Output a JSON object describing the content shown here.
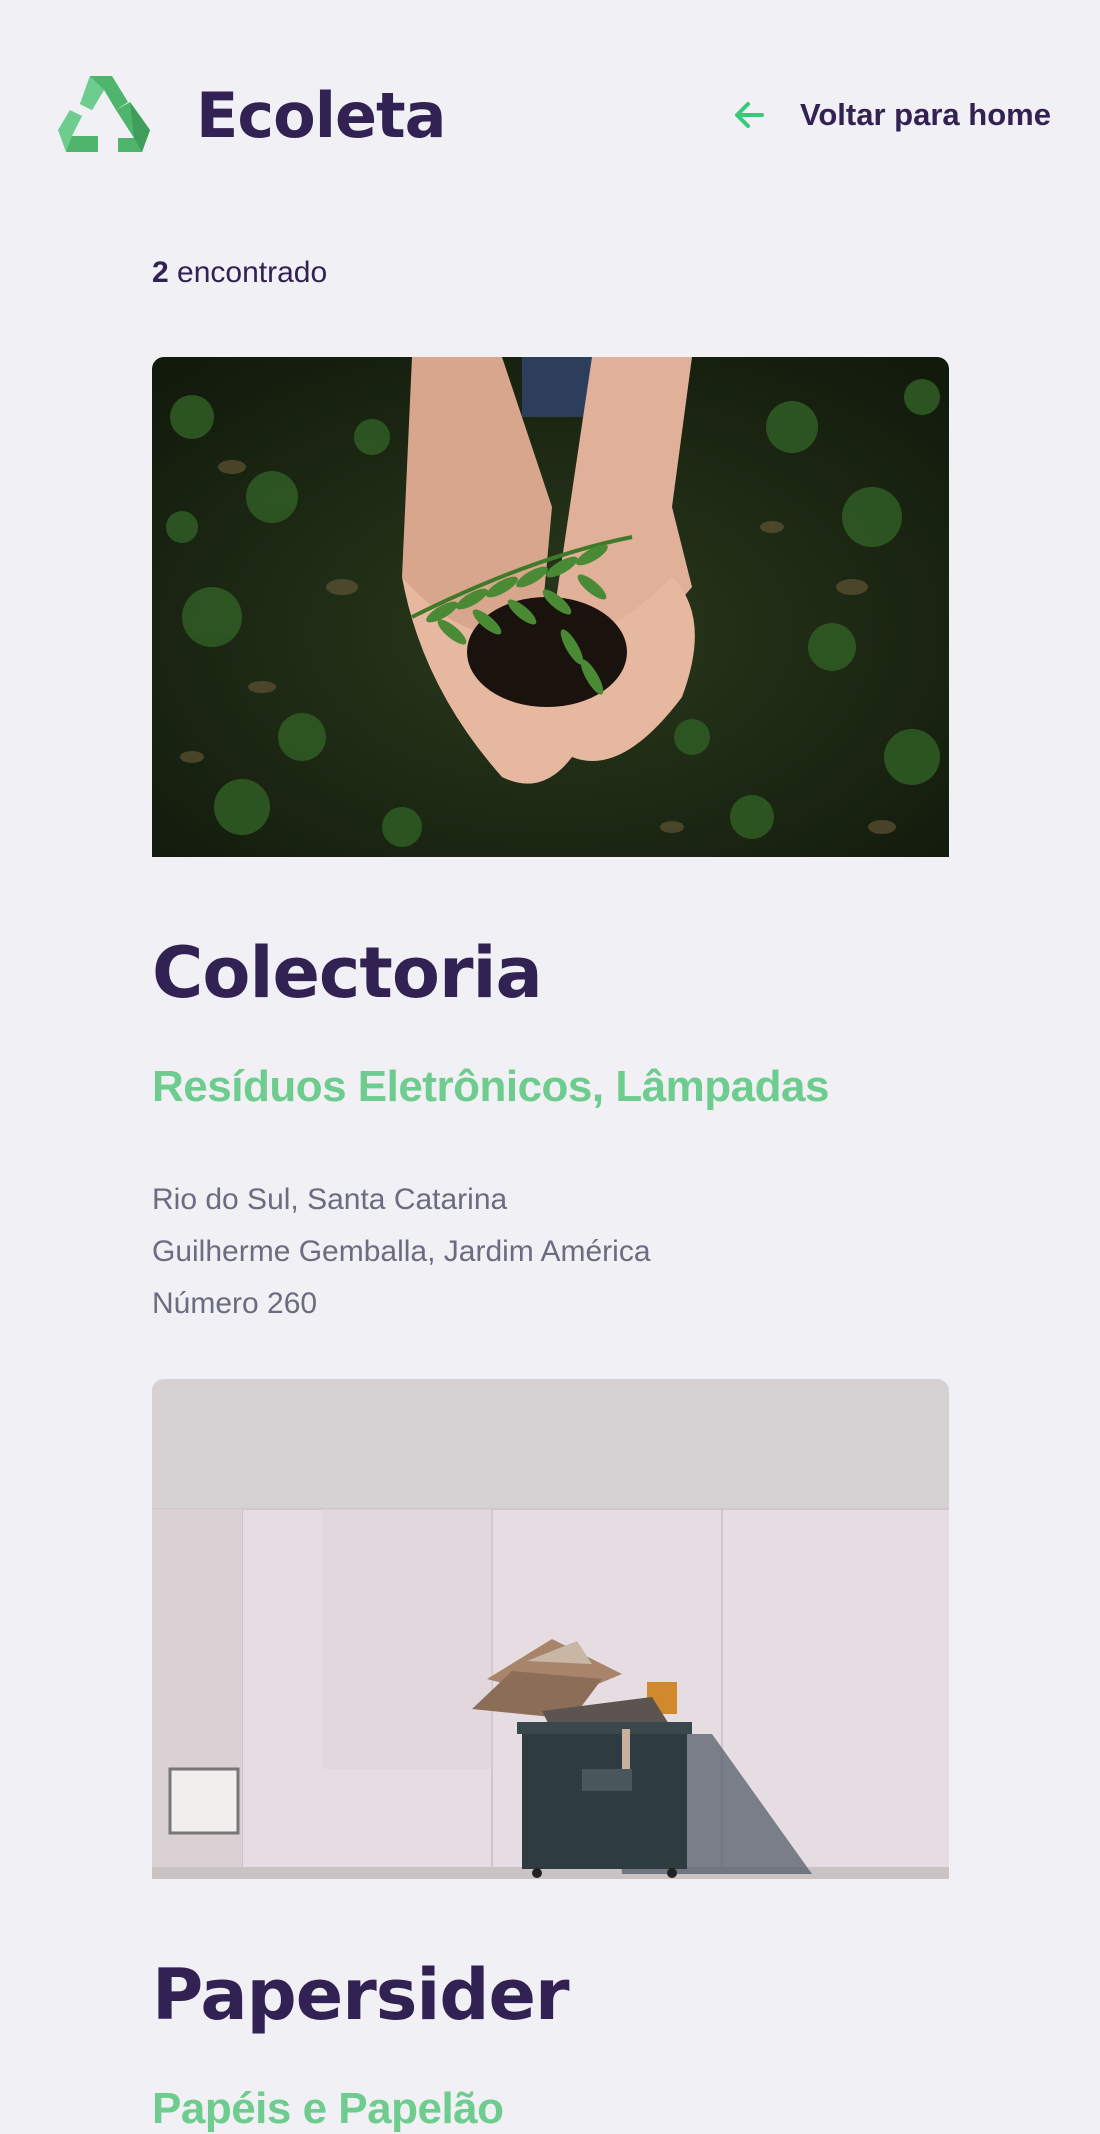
{
  "header": {
    "brand": "Ecoleta",
    "back_label": "Voltar para home"
  },
  "results": {
    "count": "2",
    "count_suffix": " encontrado"
  },
  "points": [
    {
      "name": "Colectoria",
      "items": "Resíduos Eletrônicos, Lâmpadas",
      "city_state": "Rio do Sul, Santa Catarina",
      "street_district": "Guilherme Gemballa, Jardim América",
      "number": "Número 260",
      "image": "hands-holding-plant-photo"
    },
    {
      "name": "Papersider",
      "items": "Papéis e Papelão",
      "image": "dumpster-with-cardboard-photo"
    }
  ],
  "colors": {
    "title": "#322153",
    "accent": "#34cb79",
    "items": "#6dcc8e",
    "text": "#6c6c80",
    "background": "#f0f0f5"
  }
}
